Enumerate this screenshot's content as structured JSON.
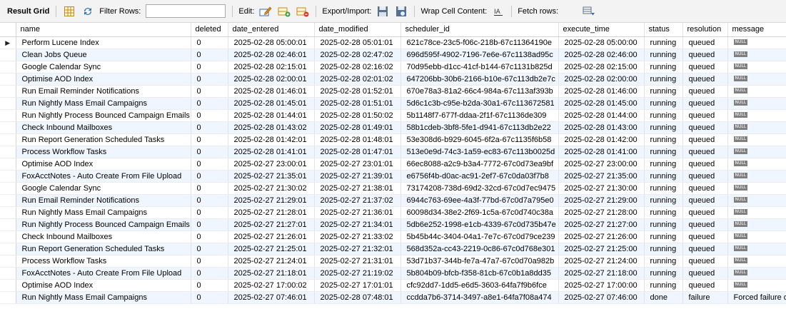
{
  "toolbar": {
    "result_grid": "Result Grid",
    "filter_rows": "Filter Rows:",
    "filter_value": "",
    "edit": "Edit:",
    "export_import": "Export/Import:",
    "wrap_cell": "Wrap Cell Content:",
    "fetch_rows": "Fetch rows:",
    "colors": {
      "accent": "#2f6fb5",
      "icon_green": "#3a9a3a",
      "icon_orange": "#e08a1a"
    }
  },
  "columns": [
    "name",
    "deleted",
    "date_entered",
    "date_modified",
    "scheduler_id",
    "execute_time",
    "status",
    "resolution",
    "message"
  ],
  "null_label": "NULL",
  "current_row_marker": "▶",
  "rows": [
    [
      "Perform Lucene Index",
      "0",
      "2025-02-28 05:00:01",
      "2025-02-28 05:01:01",
      "621c78ce-23c5-f06c-218b-67c11364190e",
      "2025-02-28 05:00:00",
      "running",
      "queued",
      null
    ],
    [
      "Clean Jobs Queue",
      "0",
      "2025-02-28 02:46:01",
      "2025-02-28 02:47:02",
      "696d595f-4902-7196-7e6e-67c1138ad95c",
      "2025-02-28 02:46:00",
      "running",
      "queued",
      null
    ],
    [
      "Google Calendar Sync",
      "0",
      "2025-02-28 02:15:01",
      "2025-02-28 02:16:02",
      "70d95ebb-d1cc-41cf-b144-67c1131b825d",
      "2025-02-28 02:15:00",
      "running",
      "queued",
      null
    ],
    [
      "Optimise AOD Index",
      "0",
      "2025-02-28 02:00:01",
      "2025-02-28 02:01:02",
      "647206bb-30b6-2166-b10e-67c113db2e7c",
      "2025-02-28 02:00:00",
      "running",
      "queued",
      null
    ],
    [
      "Run Email Reminder Notifications",
      "0",
      "2025-02-28 01:46:01",
      "2025-02-28 01:52:01",
      "670e78a3-81a2-66c4-984a-67c113af393b",
      "2025-02-28 01:46:00",
      "running",
      "queued",
      null
    ],
    [
      "Run Nightly Mass Email Campaigns",
      "0",
      "2025-02-28 01:45:01",
      "2025-02-28 01:51:01",
      "5d6c1c3b-c95e-b2da-30a1-67c113672581",
      "2025-02-28 01:45:00",
      "running",
      "queued",
      null
    ],
    [
      "Run Nightly Process Bounced Campaign Emails",
      "0",
      "2025-02-28 01:44:01",
      "2025-02-28 01:50:02",
      "5b1148f7-677f-ddaa-2f1f-67c1136de309",
      "2025-02-28 01:44:00",
      "running",
      "queued",
      null
    ],
    [
      "Check Inbound Mailboxes",
      "0",
      "2025-02-28 01:43:02",
      "2025-02-28 01:49:01",
      "58b1cdeb-3bf8-5fe1-d941-67c113db2e22",
      "2025-02-28 01:43:00",
      "running",
      "queued",
      null
    ],
    [
      "Run Report Generation Scheduled Tasks",
      "0",
      "2025-02-28 01:42:01",
      "2025-02-28 01:48:01",
      "53e308d6-b929-6045-6f2a-67c1135f6b58",
      "2025-02-28 01:42:00",
      "running",
      "queued",
      null
    ],
    [
      "Process Workflow Tasks",
      "0",
      "2025-02-28 01:41:01",
      "2025-02-28 01:47:01",
      "513e0e9d-74c3-1a59-ec83-67c113b0025d",
      "2025-02-28 01:41:00",
      "running",
      "queued",
      null
    ],
    [
      "Optimise AOD Index",
      "0",
      "2025-02-27 23:00:01",
      "2025-02-27 23:01:01",
      "66ec8088-a2c9-b3a4-7772-67c0d73ea9bf",
      "2025-02-27 23:00:00",
      "running",
      "queued",
      null
    ],
    [
      "FoxAcctNotes - Auto Create From File Upload",
      "0",
      "2025-02-27 21:35:01",
      "2025-02-27 21:39:01",
      "e6756f4b-d0ac-ac91-2ef7-67c0da03f7b8",
      "2025-02-27 21:35:00",
      "running",
      "queued",
      null
    ],
    [
      "Google Calendar Sync",
      "0",
      "2025-02-27 21:30:02",
      "2025-02-27 21:38:01",
      "73174208-738d-69d2-32cd-67c0d7ec9475",
      "2025-02-27 21:30:00",
      "running",
      "queued",
      null
    ],
    [
      "Run Email Reminder Notifications",
      "0",
      "2025-02-27 21:29:01",
      "2025-02-27 21:37:02",
      "6944c763-69ee-4a3f-77bd-67c0d7a795e0",
      "2025-02-27 21:29:00",
      "running",
      "queued",
      null
    ],
    [
      "Run Nightly Mass Email Campaigns",
      "0",
      "2025-02-27 21:28:01",
      "2025-02-27 21:36:01",
      "60098d34-38e2-2f69-1c5a-67c0d740c38a",
      "2025-02-27 21:28:00",
      "running",
      "queued",
      null
    ],
    [
      "Run Nightly Process Bounced Campaign Emails",
      "0",
      "2025-02-27 21:27:01",
      "2025-02-27 21:34:01",
      "5db6e252-1998-e1cb-4339-67c0d735b47e",
      "2025-02-27 21:27:00",
      "running",
      "queued",
      null
    ],
    [
      "Check Inbound Mailboxes",
      "0",
      "2025-02-27 21:26:01",
      "2025-02-27 21:33:02",
      "5b45b44c-3404-04a1-7e7c-67c0d79ce239",
      "2025-02-27 21:26:00",
      "running",
      "queued",
      null
    ],
    [
      "Run Report Generation Scheduled Tasks",
      "0",
      "2025-02-27 21:25:01",
      "2025-02-27 21:32:01",
      "568d352a-cc43-2219-0c86-67c0d768e301",
      "2025-02-27 21:25:00",
      "running",
      "queued",
      null
    ],
    [
      "Process Workflow Tasks",
      "0",
      "2025-02-27 21:24:01",
      "2025-02-27 21:31:01",
      "53d71b37-344b-fe7a-47a7-67c0d70a982b",
      "2025-02-27 21:24:00",
      "running",
      "queued",
      null
    ],
    [
      "FoxAcctNotes - Auto Create From File Upload",
      "0",
      "2025-02-27 21:18:01",
      "2025-02-27 21:19:02",
      "5b804b09-bfcb-f358-81cb-67c0b1a8dd35",
      "2025-02-27 21:18:00",
      "running",
      "queued",
      null
    ],
    [
      "Optimise AOD Index",
      "0",
      "2025-02-27 17:00:02",
      "2025-02-27 17:01:01",
      "cfc92dd7-1dd5-e6d5-3603-64fa7f9b6fce",
      "2025-02-27 17:00:00",
      "running",
      "queued",
      null
    ],
    [
      "Run Nightly Mass Email Campaigns",
      "0",
      "2025-02-27 07:46:01",
      "2025-02-28 07:48:01",
      "ccdda7b6-3714-3497-a8e1-64fa7f08a474",
      "2025-02-27 07:46:00",
      "done",
      "failure",
      "Forced failure on"
    ]
  ]
}
